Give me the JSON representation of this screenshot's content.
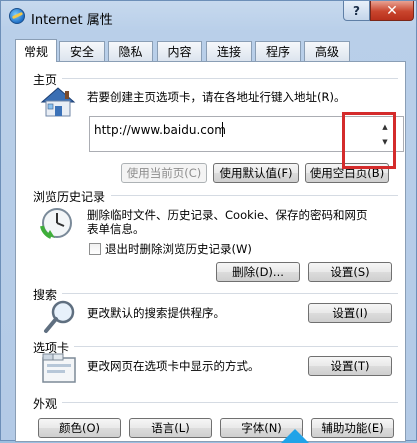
{
  "window": {
    "title": "Internet 属性",
    "help_label": "?",
    "close_label": "✕"
  },
  "tabs": [
    {
      "label": "常规"
    },
    {
      "label": "安全"
    },
    {
      "label": "隐私"
    },
    {
      "label": "内容"
    },
    {
      "label": "连接"
    },
    {
      "label": "程序"
    },
    {
      "label": "高级"
    }
  ],
  "homepage": {
    "title": "主页",
    "description": "若要创建主页选项卡，请在各地址行键入地址(R)。",
    "url": "http://www.baidu.com",
    "buttons": {
      "use_current": "使用当前页(C)",
      "use_default": "使用默认值(F)",
      "use_blank": "使用空白页(B)"
    }
  },
  "history": {
    "title": "浏览历史记录",
    "description_line1": "删除临时文件、历史记录、Cookie、保存的密码和网页",
    "description_line2": "表单信息。",
    "checkbox_label": "退出时删除浏览历史记录(W)",
    "checkbox_checked": false,
    "delete_button": "删除(D)...",
    "settings_button": "设置(S)"
  },
  "search": {
    "title": "搜索",
    "description": "更改默认的搜索提供程序。",
    "settings_button": "设置(I)"
  },
  "tabs_section": {
    "title": "选项卡",
    "description": "更改网页在选项卡中显示的方式。",
    "settings_button": "设置(T)"
  },
  "appearance": {
    "title": "外观",
    "buttons": {
      "colors": "颜色(O)",
      "languages": "语言(L)",
      "fonts": "字体(N)",
      "accessibility": "辅助功能(E)"
    }
  },
  "colors": {
    "highlight": "#d42b2b",
    "accent_arrow": "#21a3e8"
  }
}
